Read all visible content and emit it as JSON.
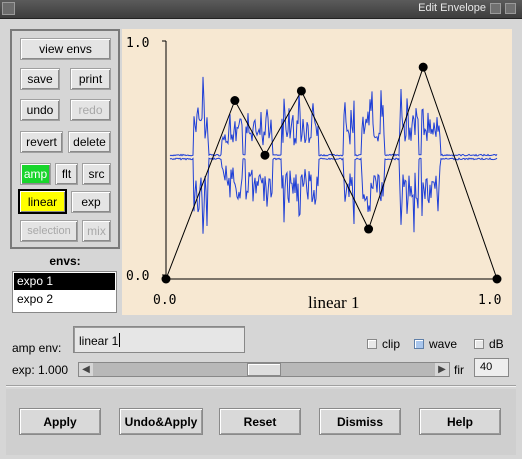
{
  "window": {
    "title": "Edit Envelope"
  },
  "panel_buttons": {
    "view_envs": "view envs",
    "save": "save",
    "print": "print",
    "undo": "undo",
    "redo": "redo",
    "revert": "revert",
    "delete": "delete",
    "amp": "amp",
    "flt": "flt",
    "src": "src",
    "linear": "linear",
    "exp": "exp",
    "selection": "selection",
    "mix": "mix"
  },
  "envs": {
    "label": "envs:",
    "items": [
      "expo 1",
      "expo 2"
    ],
    "selected": "expo 1"
  },
  "graph": {
    "y_top_label": "1.0",
    "y_bottom_label": "0.0",
    "x_left_label": "0.0",
    "x_right_label": "1.0",
    "env_name": "linear 1",
    "envelope_points": [
      [
        0.0,
        0.0
      ],
      [
        0.208,
        0.75
      ],
      [
        0.299,
        0.52
      ],
      [
        0.409,
        0.79
      ],
      [
        0.612,
        0.21
      ],
      [
        0.777,
        0.89
      ],
      [
        1.0,
        0.0
      ]
    ]
  },
  "amp_env": {
    "label": "amp env:",
    "value": "linear 1"
  },
  "toggles": {
    "clip": "clip",
    "wave": "wave",
    "db": "dB",
    "wave_checked": true
  },
  "exp": {
    "label": "exp: 1.000",
    "slider_value": 0.5
  },
  "fir": {
    "label": "fir",
    "value": "40"
  },
  "dialog_buttons": {
    "apply": "Apply",
    "undo_apply": "Undo&Apply",
    "reset": "Reset",
    "dismiss": "Dismiss",
    "help": "Help"
  },
  "colors": {
    "graph_background": "#f7e8d2",
    "waveform": "#1f3fd6",
    "amp_active": "#18d62c",
    "linear_active": "#ffff00"
  }
}
